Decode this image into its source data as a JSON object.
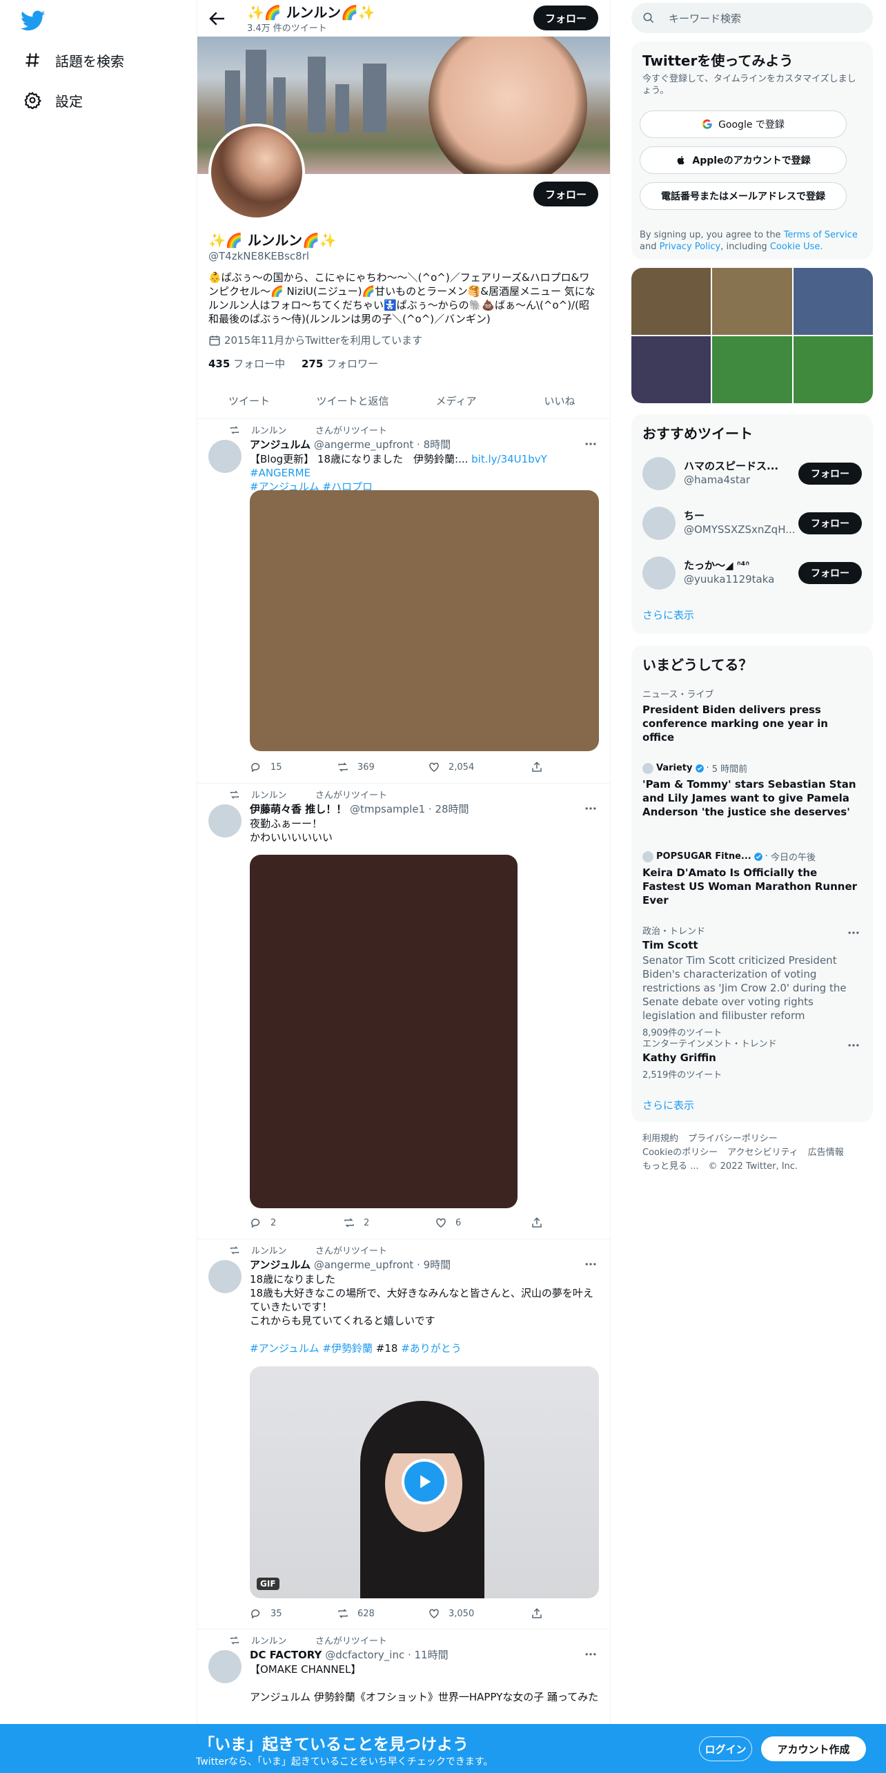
{
  "nav": {
    "items": [
      {
        "label": "話題を検索",
        "icon": "hash-icon"
      },
      {
        "label": "設定",
        "icon": "gear-icon"
      }
    ]
  },
  "header": {
    "name": "✨🌈 ルンルン🌈✨",
    "tweet_count": "3.4万 件のツイート",
    "follow_label": "フォロー"
  },
  "profile": {
    "name": "✨🌈 ルンルン🌈✨",
    "handle": "@T4zkNE8KEBsc8rl",
    "bio": "👶ぱぶぅ〜の国から、こにゃにゃちわ〜〜＼(^o^)／フェアリーズ&ハロプロ&ワンピクセル〜🌈 NiziU(ニジュー)🌈甘いものとラーメン🥞&居酒屋メニュー 気になルンルン人はフォロ〜ちてくだちゃい🚼ぱぶぅ〜からの🐘💩ばぁ〜ん\\(^o^)/(昭和最後のぱぶぅ〜侍)(ルンルンは男の子＼(^o^)／バンギン)",
    "joined": "2015年11月からTwitterを利用しています",
    "following_count": "435",
    "following_label": "フォロー中",
    "followers_count": "275",
    "followers_label": "フォロワー",
    "follow_label": "フォロー"
  },
  "tabs": [
    "ツイート",
    "ツイートと返信",
    "メディア",
    "いいね"
  ],
  "tweets": [
    {
      "retweeted_by": "ルンルン",
      "retweet_label": "さんがリツイート",
      "name": "アンジュルム",
      "handle": "@angerme_upfront",
      "time": "8時間",
      "text": "【Blog更新】 18歳になりました　伊勢鈴蘭:...",
      "link": "bit.ly/34U1bvY",
      "tag1": "#ANGERME",
      "tag2": "#アンジュルム",
      "tag3": "#ハロプロ",
      "media_color": "#86684a",
      "replies": "15",
      "retweets": "369",
      "likes": "2,054"
    },
    {
      "retweeted_by": "ルンルン",
      "retweet_label": "さんがリツイート",
      "name": "伊藤萌々香 推し！！",
      "handle": "@tmpsample1",
      "time": "28時間",
      "text": "夜勤ふぁーー！\nかわいいいいいい",
      "media_color": "#3c2420",
      "replies": "2",
      "retweets": "2",
      "likes": "6"
    },
    {
      "retweeted_by": "ルンルン",
      "retweet_label": "さんがリツイート",
      "name": "アンジュルム",
      "handle": "@angerme_upfront",
      "time": "9時間",
      "text": "18歳になりました\n18歳も大好きなこの場所で、大好きなみんなと皆さんと、沢山の夢を叶えていきたいです！\nこれからも見ていてくれると嬉しいです",
      "tag1": "#アンジュルム",
      "tag2": "#伊勢鈴蘭",
      "tag_plain": "#18",
      "tag3": "#ありがとう",
      "gif_label": "GIF",
      "replies": "35",
      "retweets": "628",
      "likes": "3,050"
    },
    {
      "retweeted_by": "ルンルン",
      "retweet_label": "さんがリツイート",
      "name": "DC FACTORY",
      "handle": "@dcfactory_inc",
      "time": "11時間",
      "text": "【OMAKE CHANNEL】\n\nアンジュルム 伊勢鈴蘭《オフショット》世界一HAPPYな女の子 踊ってみた"
    }
  ],
  "search": {
    "placeholder": "キーワード検索"
  },
  "signup": {
    "title": "Twitterを使ってみよう",
    "subtitle": "今すぐ登録して、タイムラインをカスタマイズしましょう。",
    "google": "Google で登録",
    "apple": "Appleのアカウントで登録",
    "phone": "電話番号またはメールアドレスで登録",
    "terms_prefix": "By signing up, you agree to the",
    "terms_link": "Terms of Service",
    "and": "and",
    "privacy_link": "Privacy Policy",
    "including": ", including",
    "cookie_link": "Cookie Use."
  },
  "photo_grid": {
    "colors": [
      "#6e5a3e",
      "#877350",
      "#4a628a",
      "#3e3a5a",
      "#3f8a3f",
      "#3f8a3c"
    ]
  },
  "recommend": {
    "title": "おすすめツイート",
    "users": [
      {
        "name": "ハマのスピードス...",
        "handle": "@hama4star"
      },
      {
        "name": "ちー",
        "handle": "@OMYSSXZSxnZqH..."
      },
      {
        "name": "たっか〜◢ ᐢ⁴ᐢ",
        "handle": "@yuuka1129taka"
      }
    ],
    "follow_label": "フォロー",
    "more": "さらに表示"
  },
  "trends": {
    "title": "いまどうしてる？",
    "items": [
      {
        "meta": "ニュース・ライブ",
        "title": "President Biden delivers press conference marking one year in office"
      },
      {
        "source": "Variety",
        "time": "5 時間前",
        "title": "'Pam & Tommy' stars Sebastian Stan and Lily James want to give Pamela Anderson 'the justice she deserves'"
      },
      {
        "source": "POPSUGAR Fitne...",
        "time": "今日の午後",
        "title": "Keira D'Amato Is Officially the Fastest US Woman Marathon Runner Ever"
      },
      {
        "meta": "政治・トレンド",
        "title": "Tim Scott",
        "desc": "Senator Tim Scott criticized President Biden's characterization of voting restrictions as 'Jim Crow 2.0' during the Senate debate over voting rights legislation and filibuster reform",
        "count": "8,909件のツイート"
      },
      {
        "meta": "エンターテインメント・トレンド",
        "title": "Kathy Griffin",
        "count": "2,519件のツイート"
      }
    ],
    "more": "さらに表示"
  },
  "footer": {
    "links": [
      "利用規約",
      "プライバシーポリシー",
      "Cookieのポリシー",
      "アクセシビリティ",
      "広告情報",
      "もっと見る ..."
    ],
    "copyright": "© 2022 Twitter, Inc."
  },
  "bottom_bar": {
    "title": "「いま」起きていることを見つけよう",
    "subtitle": "Twitterなら、「いま」起きていることをいち早くチェックできます。",
    "login": "ログイン",
    "signup": "アカウント作成"
  },
  "colors": {
    "accent": "#1d9bf0",
    "text": "#0f1419",
    "muted": "#536471"
  }
}
